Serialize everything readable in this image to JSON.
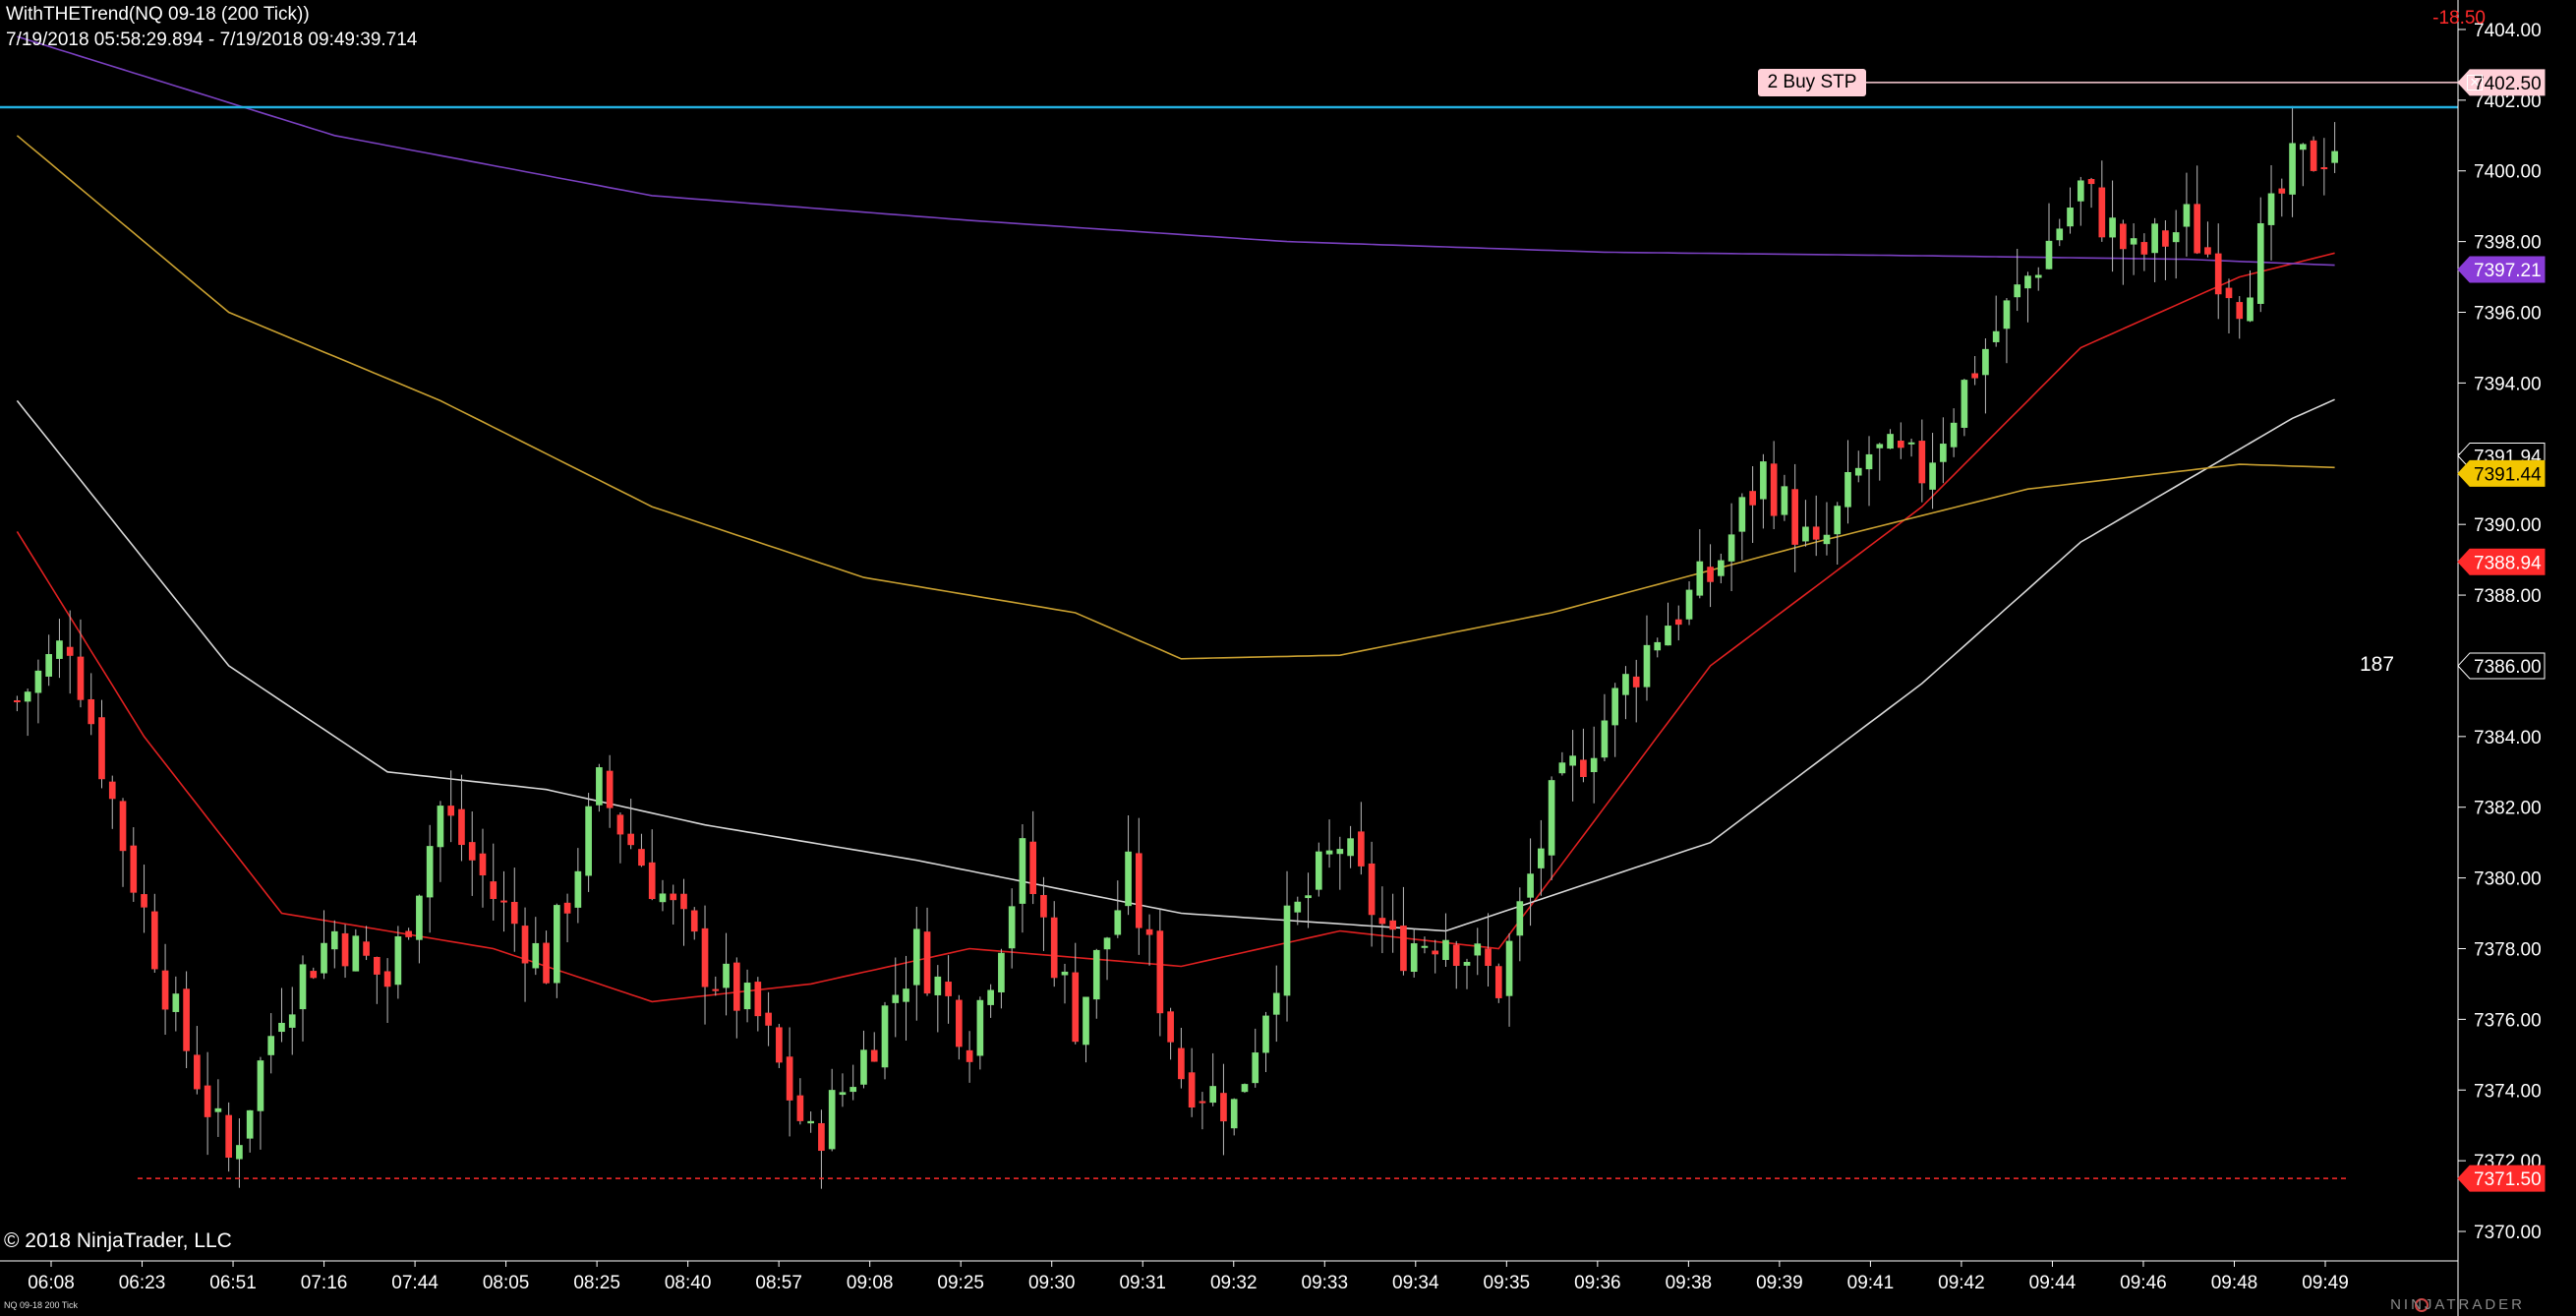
{
  "header": {
    "title": "WithTHETrend(NQ 09-18 (200 Tick))",
    "range": "7/19/2018 05:58:29.894 - 7/19/2018 09:49:39.714"
  },
  "copyright": "© 2018 NinjaTrader, LLC",
  "pnl": "-18.50",
  "order": {
    "label": "2 Buy STP",
    "price": 7402.5,
    "price_label": "7402.50"
  },
  "tick_counter": "187",
  "footer_instrument": "NQ 09-18 200 Tick",
  "brand": "NINJATRADER",
  "colors": {
    "background": "#000000",
    "up": "#7ee07a",
    "down": "#ff3b3b",
    "ema_fast": "#e02020",
    "sma_white": "#d8d8d8",
    "sma_gold": "#c9a030",
    "sma_purple": "#7a40c0",
    "cyan_line": "#23b0e0",
    "order_line": "#ffd0d8"
  },
  "chart_data": {
    "type": "candlestick",
    "y_axis": {
      "min": 7369.5,
      "max": 7404.5,
      "ticks": [
        "7404.00",
        "7402.00",
        "7400.00",
        "7398.00",
        "7396.00",
        "7394.00",
        "7392.00",
        "7390.00",
        "7388.00",
        "7386.00",
        "7384.00",
        "7382.00",
        "7380.00",
        "7378.00",
        "7376.00",
        "7374.00",
        "7372.00",
        "7370.00"
      ]
    },
    "x_axis": {
      "labels": [
        "06:08",
        "06:23",
        "06:51",
        "07:16",
        "07:44",
        "08:05",
        "08:25",
        "08:40",
        "08:57",
        "09:08",
        "09:25",
        "09:30",
        "09:31",
        "09:32",
        "09:33",
        "09:34",
        "09:35",
        "09:36",
        "09:38",
        "09:39",
        "09:41",
        "09:42",
        "09:44",
        "09:46",
        "09:48",
        "09:49"
      ]
    },
    "price_badges": [
      {
        "label": "7397.21",
        "value": 7397.21,
        "color": "#8a3cd8",
        "text": "#ffffff"
      },
      {
        "label": "7391.94",
        "value": 7391.94,
        "color": "#000000",
        "text": "#ffffff"
      },
      {
        "label": "7391.44",
        "value": 7391.44,
        "color": "#f2c600",
        "text": "#000000"
      },
      {
        "label": "7388.94",
        "value": 7388.94,
        "color": "#ff2a2a",
        "text": "#ffffff"
      },
      {
        "label": "7386.00",
        "value": 7386.0,
        "color": "#000000",
        "text": "#ffffff"
      },
      {
        "label": "7371.50",
        "value": 7371.5,
        "color": "#ff2a2a",
        "text": "#ffffff"
      }
    ],
    "horizontal_lines": [
      {
        "value": 7401.8,
        "color": "#23b0e0",
        "style": "solid"
      },
      {
        "value": 7371.5,
        "color": "#ff2a2a",
        "style": "dashed"
      }
    ],
    "bars_count": 220,
    "close_anchors": [
      [
        0,
        7385.0
      ],
      [
        5,
        7386.8
      ],
      [
        10,
        7381.0
      ],
      [
        15,
        7376.0
      ],
      [
        20,
        7372.0
      ],
      [
        25,
        7376.5
      ],
      [
        30,
        7378.5
      ],
      [
        35,
        7377.0
      ],
      [
        40,
        7382.0
      ],
      [
        45,
        7379.5
      ],
      [
        50,
        7377.5
      ],
      [
        55,
        7382.5
      ],
      [
        60,
        7380.0
      ],
      [
        65,
        7377.5
      ],
      [
        70,
        7376.0
      ],
      [
        75,
        7372.5
      ],
      [
        80,
        7375.0
      ],
      [
        85,
        7378.0
      ],
      [
        90,
        7375.5
      ],
      [
        95,
        7380.5
      ],
      [
        100,
        7376.0
      ],
      [
        105,
        7380.0
      ],
      [
        110,
        7374.5
      ],
      [
        115,
        7373.5
      ],
      [
        120,
        7378.5
      ],
      [
        125,
        7381.0
      ],
      [
        130,
        7378.0
      ],
      [
        135,
        7378.5
      ],
      [
        140,
        7377.0
      ],
      [
        145,
        7382.0
      ],
      [
        150,
        7384.5
      ],
      [
        155,
        7387.0
      ],
      [
        160,
        7388.5
      ],
      [
        165,
        7391.5
      ],
      [
        170,
        7389.0
      ],
      [
        175,
        7392.0
      ],
      [
        180,
        7391.5
      ],
      [
        185,
        7394.5
      ],
      [
        190,
        7397.0
      ],
      [
        195,
        7399.5
      ],
      [
        200,
        7397.5
      ],
      [
        205,
        7398.5
      ],
      [
        210,
        7396.5
      ],
      [
        215,
        7400.0
      ],
      [
        220,
        7401.0
      ],
      [
        225,
        7399.5
      ],
      [
        230,
        7398.0
      ]
    ],
    "indicators": [
      {
        "name": "EMA fast",
        "color": "#e02020",
        "anchors": [
          [
            0,
            7389.8
          ],
          [
            12,
            7384.0
          ],
          [
            25,
            7379.0
          ],
          [
            45,
            7378.0
          ],
          [
            60,
            7376.5
          ],
          [
            75,
            7377.0
          ],
          [
            90,
            7378.0
          ],
          [
            110,
            7377.5
          ],
          [
            125,
            7378.5
          ],
          [
            140,
            7378.0
          ],
          [
            160,
            7386.0
          ],
          [
            180,
            7390.5
          ],
          [
            195,
            7395.0
          ],
          [
            210,
            7397.0
          ],
          [
            230,
            7398.5
          ]
        ]
      },
      {
        "name": "SMA white",
        "color": "#d8d8d8",
        "anchors": [
          [
            0,
            7393.5
          ],
          [
            20,
            7386.0
          ],
          [
            35,
            7383.0
          ],
          [
            50,
            7382.5
          ],
          [
            65,
            7381.5
          ],
          [
            85,
            7380.5
          ],
          [
            110,
            7379.0
          ],
          [
            135,
            7378.5
          ],
          [
            160,
            7381.0
          ],
          [
            180,
            7385.5
          ],
          [
            195,
            7389.5
          ],
          [
            215,
            7393.0
          ],
          [
            230,
            7395.0
          ]
        ]
      },
      {
        "name": "SMA gold",
        "color": "#c9a030",
        "anchors": [
          [
            0,
            7401.0
          ],
          [
            20,
            7396.0
          ],
          [
            40,
            7393.5
          ],
          [
            60,
            7390.5
          ],
          [
            80,
            7388.5
          ],
          [
            100,
            7387.5
          ],
          [
            110,
            7386.2
          ],
          [
            125,
            7386.3
          ],
          [
            145,
            7387.5
          ],
          [
            170,
            7389.5
          ],
          [
            190,
            7391.0
          ],
          [
            210,
            7391.7
          ],
          [
            230,
            7391.5
          ]
        ]
      },
      {
        "name": "SMA purple",
        "color": "#7a40c0",
        "anchors": [
          [
            0,
            7403.8
          ],
          [
            30,
            7401.0
          ],
          [
            60,
            7399.3
          ],
          [
            90,
            7398.6
          ],
          [
            120,
            7398.0
          ],
          [
            150,
            7397.7
          ],
          [
            180,
            7397.6
          ],
          [
            205,
            7397.5
          ],
          [
            230,
            7397.2
          ]
        ]
      }
    ]
  }
}
